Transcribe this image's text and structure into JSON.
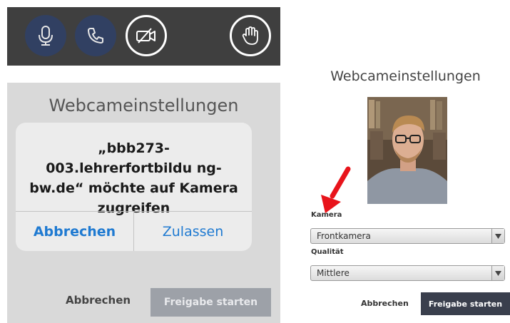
{
  "toolbar": {
    "buttons": [
      {
        "icon": "microphone-icon"
      },
      {
        "icon": "phone-icon"
      },
      {
        "icon": "video-off-icon"
      },
      {
        "icon": "raise-hand-icon"
      }
    ],
    "colors": {
      "bar": "#3f3f3f",
      "active": "#314062"
    }
  },
  "left_dialog": {
    "title": "Webcameinstellungen",
    "alert": {
      "message": "„bbb273-003.lehrerfortbildu ng-bw.de“ möchte auf Kamera zugreifen",
      "cancel_label": "Abbrechen",
      "allow_label": "Zulassen"
    },
    "cancel_label": "Abbrechen",
    "start_label": "Freigabe starten"
  },
  "right_dialog": {
    "title": "Webcameinstellungen",
    "camera_label": "Kamera",
    "camera_value": "Frontkamera",
    "quality_label": "Qualität",
    "quality_value": "Mittlere",
    "cancel_label": "Abbrechen",
    "start_label": "Freigabe starten"
  },
  "colors": {
    "accent_blue": "#1f7ad1",
    "arrow_red": "#e8141b",
    "primary_button": "#3a3f4d"
  }
}
